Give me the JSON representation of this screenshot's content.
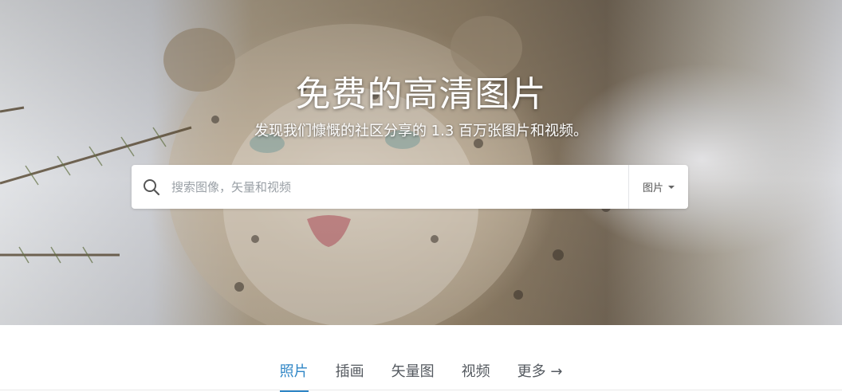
{
  "hero": {
    "title": "免费的高清图片",
    "subtitle": "发现我们慷慨的社区分享的 1.3 百万张图片和视频。",
    "background_image": "snow leopard close-up in snow"
  },
  "search": {
    "placeholder": "搜索图像，矢量和视频",
    "icon": "search-icon",
    "type_selected": "图片",
    "type_icon": "chevron-down-icon"
  },
  "tabs": [
    {
      "label": "照片",
      "active": true
    },
    {
      "label": "插画",
      "active": false
    },
    {
      "label": "矢量图",
      "active": false
    },
    {
      "label": "视频",
      "active": false
    },
    {
      "label": "更多 →",
      "active": false
    }
  ],
  "colors": {
    "accent": "#2f86c6",
    "tab_text": "#555a60"
  }
}
